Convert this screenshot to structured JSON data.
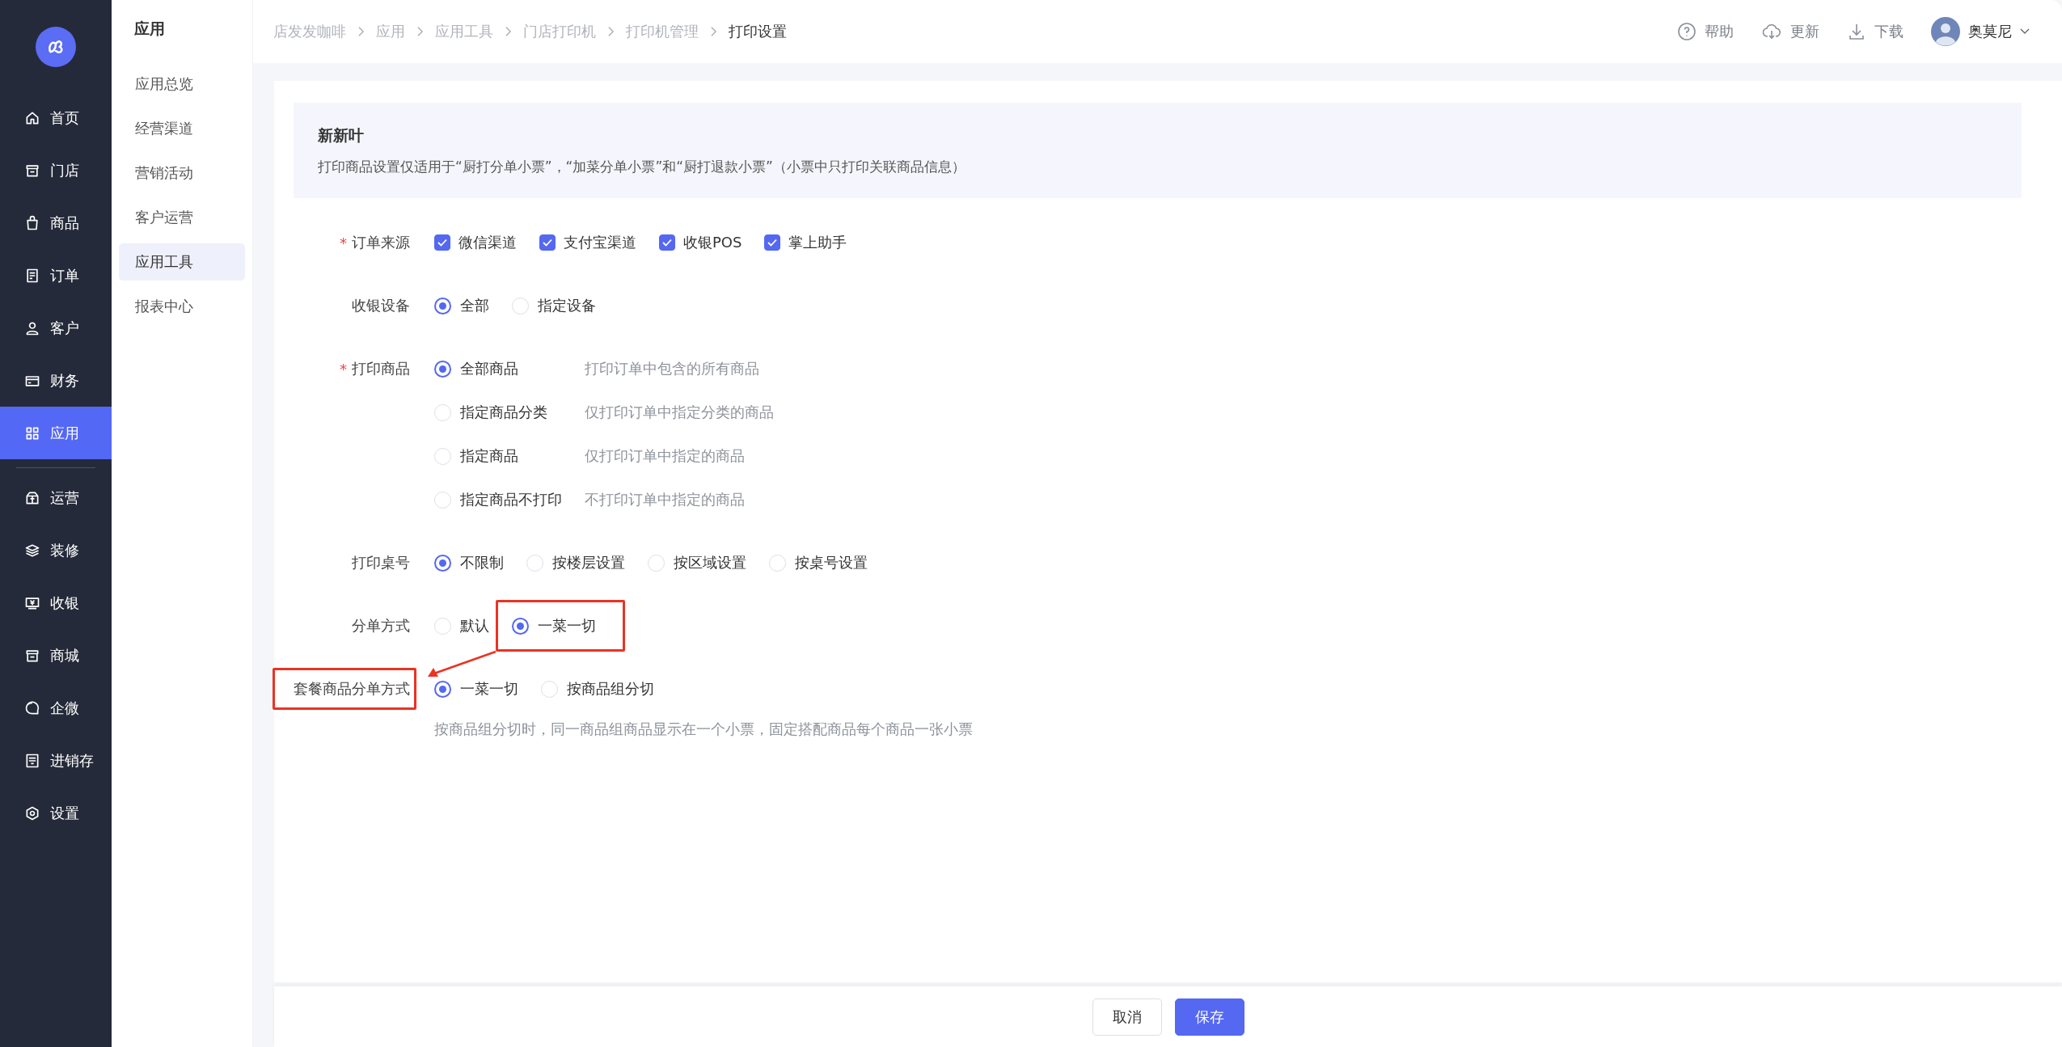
{
  "nav": {
    "primary": [
      {
        "label": "首页",
        "selected": false
      },
      {
        "label": "门店",
        "selected": false
      },
      {
        "label": "商品",
        "selected": false
      },
      {
        "label": "订单",
        "selected": false
      },
      {
        "label": "客户",
        "selected": false
      },
      {
        "label": "财务",
        "selected": false
      },
      {
        "label": "应用",
        "selected": true
      }
    ],
    "secondary": [
      {
        "label": "运营",
        "selected": false
      },
      {
        "label": "装修",
        "selected": false
      },
      {
        "label": "收银",
        "selected": false
      },
      {
        "label": "商城",
        "selected": false
      },
      {
        "label": "企微",
        "selected": false
      },
      {
        "label": "进销存",
        "selected": false
      },
      {
        "label": "设置",
        "selected": false
      }
    ]
  },
  "subnav": {
    "title": "应用",
    "items": [
      {
        "label": "应用总览",
        "selected": false
      },
      {
        "label": "经营渠道",
        "selected": false
      },
      {
        "label": "营销活动",
        "selected": false
      },
      {
        "label": "客户运营",
        "selected": false
      },
      {
        "label": "应用工具",
        "selected": true
      },
      {
        "label": "报表中心",
        "selected": false
      }
    ]
  },
  "breadcrumb": [
    "店发发咖啡",
    "应用",
    "应用工具",
    "门店打印机",
    "打印机管理",
    "打印设置"
  ],
  "header_actions": [
    {
      "label": "帮助"
    },
    {
      "label": "更新"
    },
    {
      "label": "下载"
    }
  ],
  "user": {
    "name": "奥莫尼"
  },
  "notice": {
    "title": "新新叶",
    "text": "打印商品设置仅适用于“厨打分单小票”，“加菜分单小票”和“厨打退款小票”（小票中只打印关联商品信息）"
  },
  "form": {
    "fields": [
      {
        "label": "订单来源",
        "required_mark": "*",
        "kind": "checkbox",
        "options": [
          {
            "label": "微信渠道",
            "checked": true
          },
          {
            "label": "支付宝渠道",
            "checked": true
          },
          {
            "label": "收银POS",
            "checked": true
          },
          {
            "label": "掌上助手",
            "checked": true
          }
        ]
      },
      {
        "label": "收银设备",
        "kind": "radio",
        "options": [
          {
            "label": "全部",
            "selected": true
          },
          {
            "label": "指定设备",
            "selected": false
          }
        ]
      },
      {
        "label": "打印商品",
        "required_mark": "*",
        "kind": "radio-list",
        "options": [
          {
            "label": "全部商品",
            "selected": true,
            "hint": "打印订单中包含的所有商品"
          },
          {
            "label": "指定商品分类",
            "selected": false,
            "hint": "仅打印订单中指定分类的商品"
          },
          {
            "label": "指定商品",
            "selected": false,
            "hint": "仅打印订单中指定的商品"
          },
          {
            "label": "指定商品不打印",
            "selected": false,
            "hint": "不打印订单中指定的商品"
          }
        ]
      },
      {
        "label": "打印桌号",
        "kind": "radio",
        "options": [
          {
            "label": "不限制",
            "selected": true
          },
          {
            "label": "按楼层设置",
            "selected": false
          },
          {
            "label": "按区域设置",
            "selected": false
          },
          {
            "label": "按桌号设置",
            "selected": false
          }
        ]
      },
      {
        "label": "分单方式",
        "kind": "radio",
        "options": [
          {
            "label": "默认",
            "selected": false
          },
          {
            "label": "一菜一切",
            "selected": true,
            "highlighted": true
          }
        ]
      },
      {
        "label": "套餐商品分单方式",
        "label_highlighted": true,
        "kind": "radio",
        "options": [
          {
            "label": "一菜一切",
            "selected": true
          },
          {
            "label": "按商品组分切",
            "selected": false
          }
        ],
        "hint": "按商品组分切时，同一商品组商品显示在一个小票，固定搭配商品每个商品一张小票"
      }
    ]
  },
  "footer": {
    "buttons": [
      {
        "label": "取消",
        "kind": "default"
      },
      {
        "label": "保存",
        "kind": "primary"
      }
    ]
  }
}
